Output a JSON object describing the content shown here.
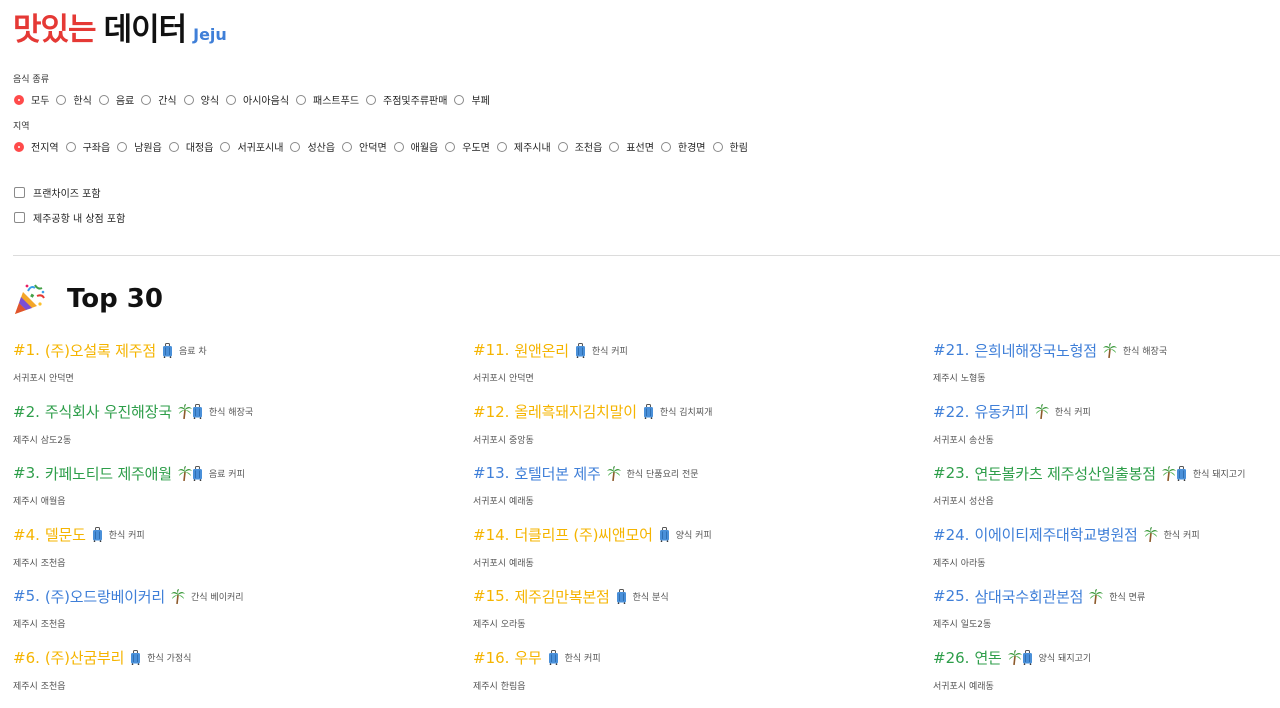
{
  "header": {
    "title_part1": "맛있는",
    "title_part2": "데이터",
    "region_label": "Jeju"
  },
  "filters": {
    "food_type": {
      "label": "음식 종류",
      "options": [
        "모두",
        "한식",
        "음료",
        "간식",
        "양식",
        "아시아음식",
        "패스트푸드",
        "주점및주류판매",
        "부페"
      ],
      "selected": "모두"
    },
    "region": {
      "label": "지역",
      "options": [
        "전지역",
        "구좌읍",
        "남원읍",
        "대정읍",
        "서귀포시내",
        "성산읍",
        "안덕면",
        "애월읍",
        "우도면",
        "제주시내",
        "조천읍",
        "표선면",
        "한경면",
        "한림"
      ],
      "selected": "전지역"
    },
    "checkboxes": [
      {
        "label": "프랜차이즈 포함",
        "checked": false
      },
      {
        "label": "제주공항 내 상점 포함",
        "checked": false
      }
    ]
  },
  "ranking": {
    "title": "Top 30",
    "colors": {
      "green": "#2e9e4a",
      "orange": "#f5b400",
      "blue": "#3f7fd8"
    },
    "columns": [
      [
        {
          "rank": "#1.",
          "name": "(주)오설록 제주점",
          "color": "orange",
          "icons": [
            "suitcase-icon"
          ],
          "tags": "음료 차",
          "location": "서귀포시 안덕면"
        },
        {
          "rank": "#2.",
          "name": "주식회사 우진해장국",
          "color": "green",
          "icons": [
            "palm-tree-icon",
            "suitcase-icon"
          ],
          "tags": "한식 해장국",
          "location": "제주시 삼도2동"
        },
        {
          "rank": "#3.",
          "name": "카페노티드 제주애월",
          "color": "green",
          "icons": [
            "palm-tree-icon",
            "suitcase-icon"
          ],
          "tags": "음료 커피",
          "location": "제주시 애월읍"
        },
        {
          "rank": "#4.",
          "name": "델문도",
          "color": "orange",
          "icons": [
            "suitcase-icon"
          ],
          "tags": "한식 커피",
          "location": "제주시 조천읍"
        },
        {
          "rank": "#5.",
          "name": "(주)오드랑베이커리",
          "color": "blue",
          "icons": [
            "palm-tree-icon"
          ],
          "tags": "간식 베이커리",
          "location": "제주시 조천읍"
        },
        {
          "rank": "#6.",
          "name": "(주)산굼부리",
          "color": "orange",
          "icons": [
            "suitcase-icon"
          ],
          "tags": "한식 가정식",
          "location": "제주시 조천읍"
        }
      ],
      [
        {
          "rank": "#11.",
          "name": "원앤온리",
          "color": "orange",
          "icons": [
            "suitcase-icon"
          ],
          "tags": "한식 커피",
          "location": "서귀포시 안덕면"
        },
        {
          "rank": "#12.",
          "name": "올레흑돼지김치말이",
          "color": "orange",
          "icons": [
            "suitcase-icon"
          ],
          "tags": "한식 김치찌개",
          "location": "서귀포시 중앙동"
        },
        {
          "rank": "#13.",
          "name": "호텔더본 제주",
          "color": "blue",
          "icons": [
            "palm-tree-icon"
          ],
          "tags": "한식 단품요리 전문",
          "location": "서귀포시 예래동"
        },
        {
          "rank": "#14.",
          "name": "더클리프 (주)씨앤모어",
          "color": "orange",
          "icons": [
            "suitcase-icon"
          ],
          "tags": "양식 커피",
          "location": "서귀포시 예래동"
        },
        {
          "rank": "#15.",
          "name": "제주김만복본점",
          "color": "orange",
          "icons": [
            "suitcase-icon"
          ],
          "tags": "한식 분식",
          "location": "제주시 오라동"
        },
        {
          "rank": "#16.",
          "name": "우무",
          "color": "orange",
          "icons": [
            "suitcase-icon"
          ],
          "tags": "한식 커피",
          "location": "제주시 한림읍"
        }
      ],
      [
        {
          "rank": "#21.",
          "name": "은희네해장국노형점",
          "color": "blue",
          "icons": [
            "palm-tree-icon"
          ],
          "tags": "한식 해장국",
          "location": "제주시 노형동"
        },
        {
          "rank": "#22.",
          "name": "유동커피",
          "color": "blue",
          "icons": [
            "palm-tree-icon"
          ],
          "tags": "한식 커피",
          "location": "서귀포시 송산동"
        },
        {
          "rank": "#23.",
          "name": "연돈볼카츠 제주성산일출봉점",
          "color": "green",
          "icons": [
            "palm-tree-icon",
            "suitcase-icon"
          ],
          "tags": "한식 돼지고기",
          "location": "서귀포시 성산읍"
        },
        {
          "rank": "#24.",
          "name": "이에이티제주대학교병원점",
          "color": "blue",
          "icons": [
            "palm-tree-icon"
          ],
          "tags": "한식 커피",
          "location": "제주시 아라동"
        },
        {
          "rank": "#25.",
          "name": "삼대국수회관본점",
          "color": "blue",
          "icons": [
            "palm-tree-icon"
          ],
          "tags": "한식 면류",
          "location": "제주시 일도2동"
        },
        {
          "rank": "#26.",
          "name": "연돈",
          "color": "green",
          "icons": [
            "palm-tree-icon",
            "suitcase-icon"
          ],
          "tags": "양식 돼지고기",
          "location": "서귀포시 예래동"
        }
      ]
    ]
  }
}
